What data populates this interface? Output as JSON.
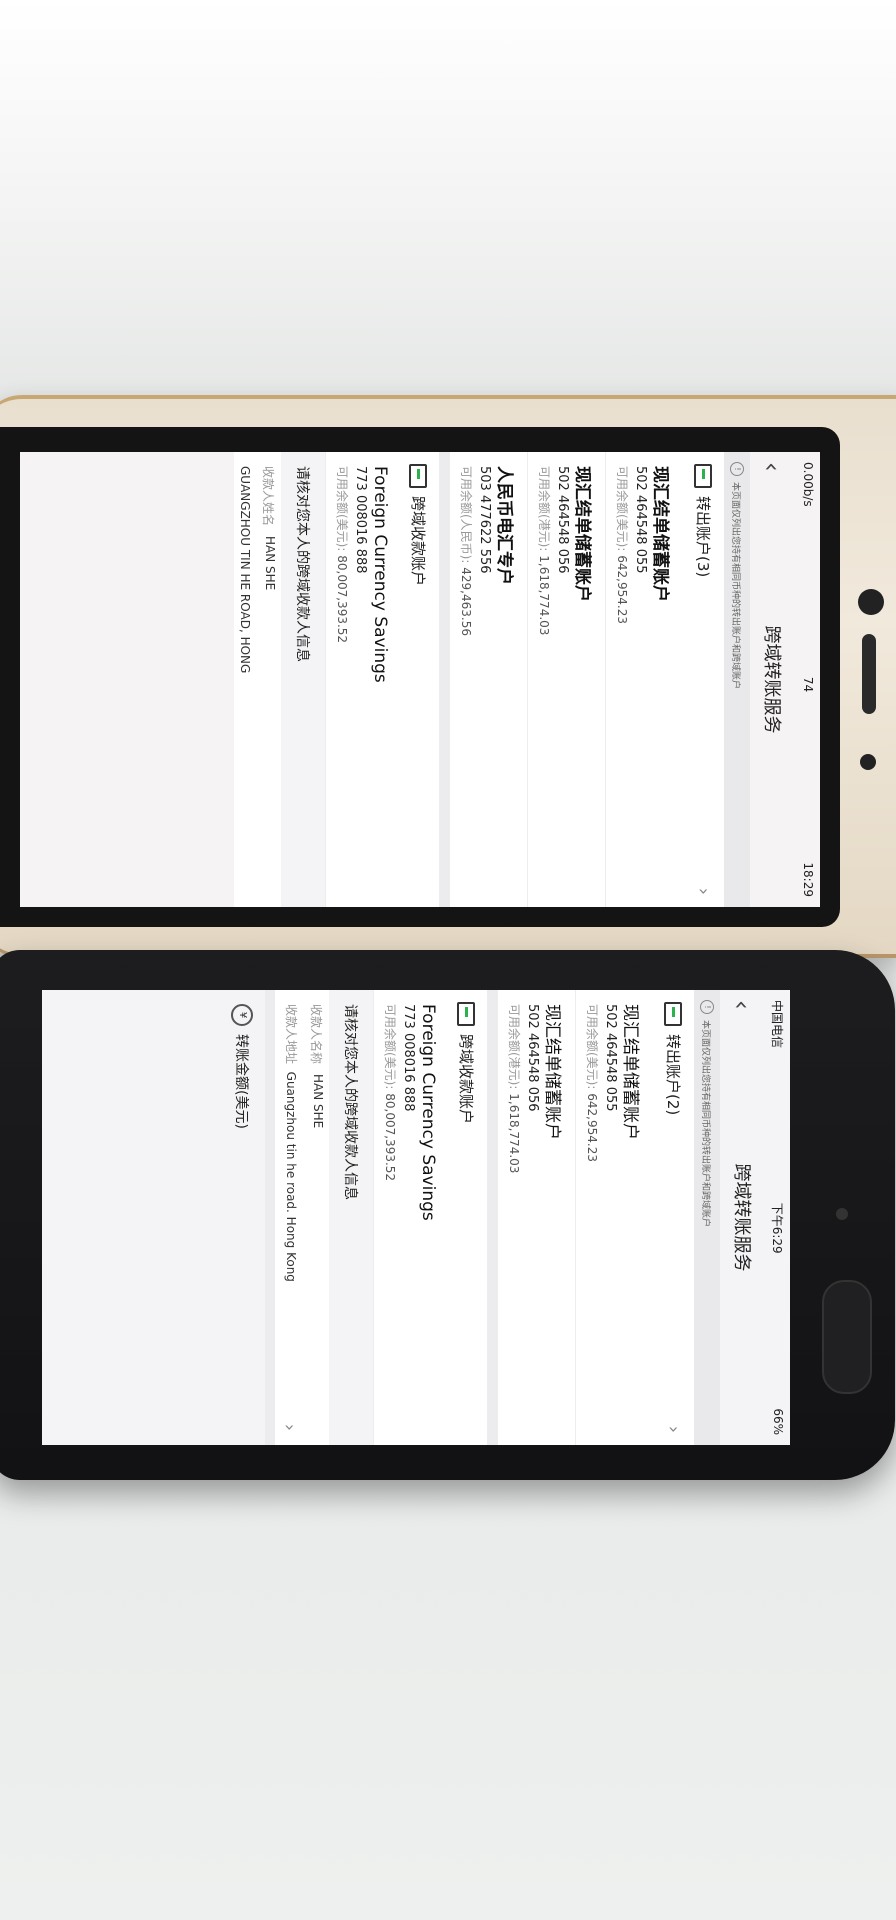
{
  "phone1": {
    "status": {
      "speed": "0.00b/s",
      "signal": "74",
      "time": "18:29"
    },
    "title": "跨域转账服务",
    "notice": "本页面仅列出您持有相同币种的转出账户和跨域账户",
    "out_header": "转出账户(3)",
    "out_accounts": [
      {
        "name": "现汇结单储蓄账户",
        "number": "502 464548 055",
        "balance_label": "可用余额(美元):",
        "balance": "642,954.23"
      },
      {
        "name": "现汇结单储蓄账户",
        "number": "502 464548 056",
        "balance_label": "可用余额(港元):",
        "balance": "1,618,774.03"
      },
      {
        "name": "人民币电汇专户",
        "number": "503 477622 556",
        "balance_label": "可用余额(人民币):",
        "balance": "429,463.56"
      }
    ],
    "in_header": "跨域收款账户",
    "in_account": {
      "name": "Foreign Currency Savings",
      "number": "773 008016 888",
      "balance_label": "可用余额(美元):",
      "balance": "80,007,393.52"
    },
    "confirm": "请核对您本人的跨域收款人信息",
    "payee_name_label": "收款人姓名",
    "payee_name": "HAN SHE",
    "payee_addr": "GUANGZHOU TIN HE ROAD, HONG"
  },
  "phone2": {
    "status": {
      "carrier": "中国电信",
      "time": "下午6:29",
      "battery": "66%"
    },
    "title": "跨域转账服务",
    "notice": "本页面仅列出您持有相同币种的转出账户和跨域账户",
    "out_header": "转出账户(2)",
    "out_accounts": [
      {
        "name": "现汇结单储蓄账户",
        "number": "502 464548 055",
        "balance_label": "可用余额(美元):",
        "balance": "642,954.23"
      },
      {
        "name": "现汇结单储蓄账户",
        "number": "502 464548 056",
        "balance_label": "可用余额(港元):",
        "balance": "1,618,774.03"
      }
    ],
    "in_header": "跨域收款账户",
    "in_account": {
      "name": "Foreign Currency Savings",
      "number": "773 008016 888",
      "balance_label": "可用余额(美元):",
      "balance": "80,007,393.52"
    },
    "confirm": "请核对您本人的跨域收款人信息",
    "payee_name_label": "收款人名称",
    "payee_name": "HAN SHE",
    "payee_addr_label": "收款人地址",
    "payee_addr": "Guangzhou tin he road. Hong Kong",
    "amount_label": "转账金额(美元)"
  },
  "icons": {
    "back": "chevron-left-icon",
    "chevron": "chevron-right-icon",
    "account": "account-card-icon",
    "info": "info-icon",
    "coin": "coin-icon"
  }
}
